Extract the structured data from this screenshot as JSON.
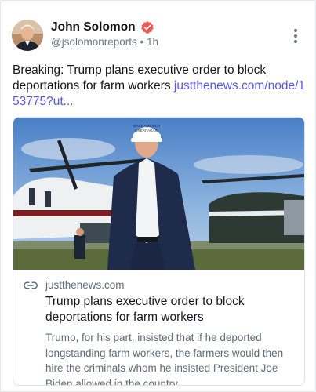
{
  "post": {
    "author_name": "John Solomon",
    "handle": "@jsolomonreports",
    "separator": "•",
    "time_ago": "1h",
    "text": "Breaking: Trump plans executive order to block deportations for farm workers ",
    "link_text": "justthenews.com/node/153775?ut..."
  },
  "link_card": {
    "domain": "justthenews.com",
    "title": "Trump plans executive order to block deportations for farm workers",
    "description": "Trump, for his part, insisted that if he deported longstanding farm workers, the farmers would then hire the criminals whom he insisted President Joe Biden allowed in the country.",
    "image_alt": "Trump walking in front of helicopters",
    "cap_text_1": "MAKE AMERICA",
    "cap_text_2": "GREAT AGAIN"
  },
  "icons": {
    "verified": "verified-badge-icon",
    "more": "more-vertical-icon",
    "link": "link-icon"
  },
  "colors": {
    "link": "#5b57e8",
    "verified": "#f0544f",
    "muted": "#687684"
  }
}
